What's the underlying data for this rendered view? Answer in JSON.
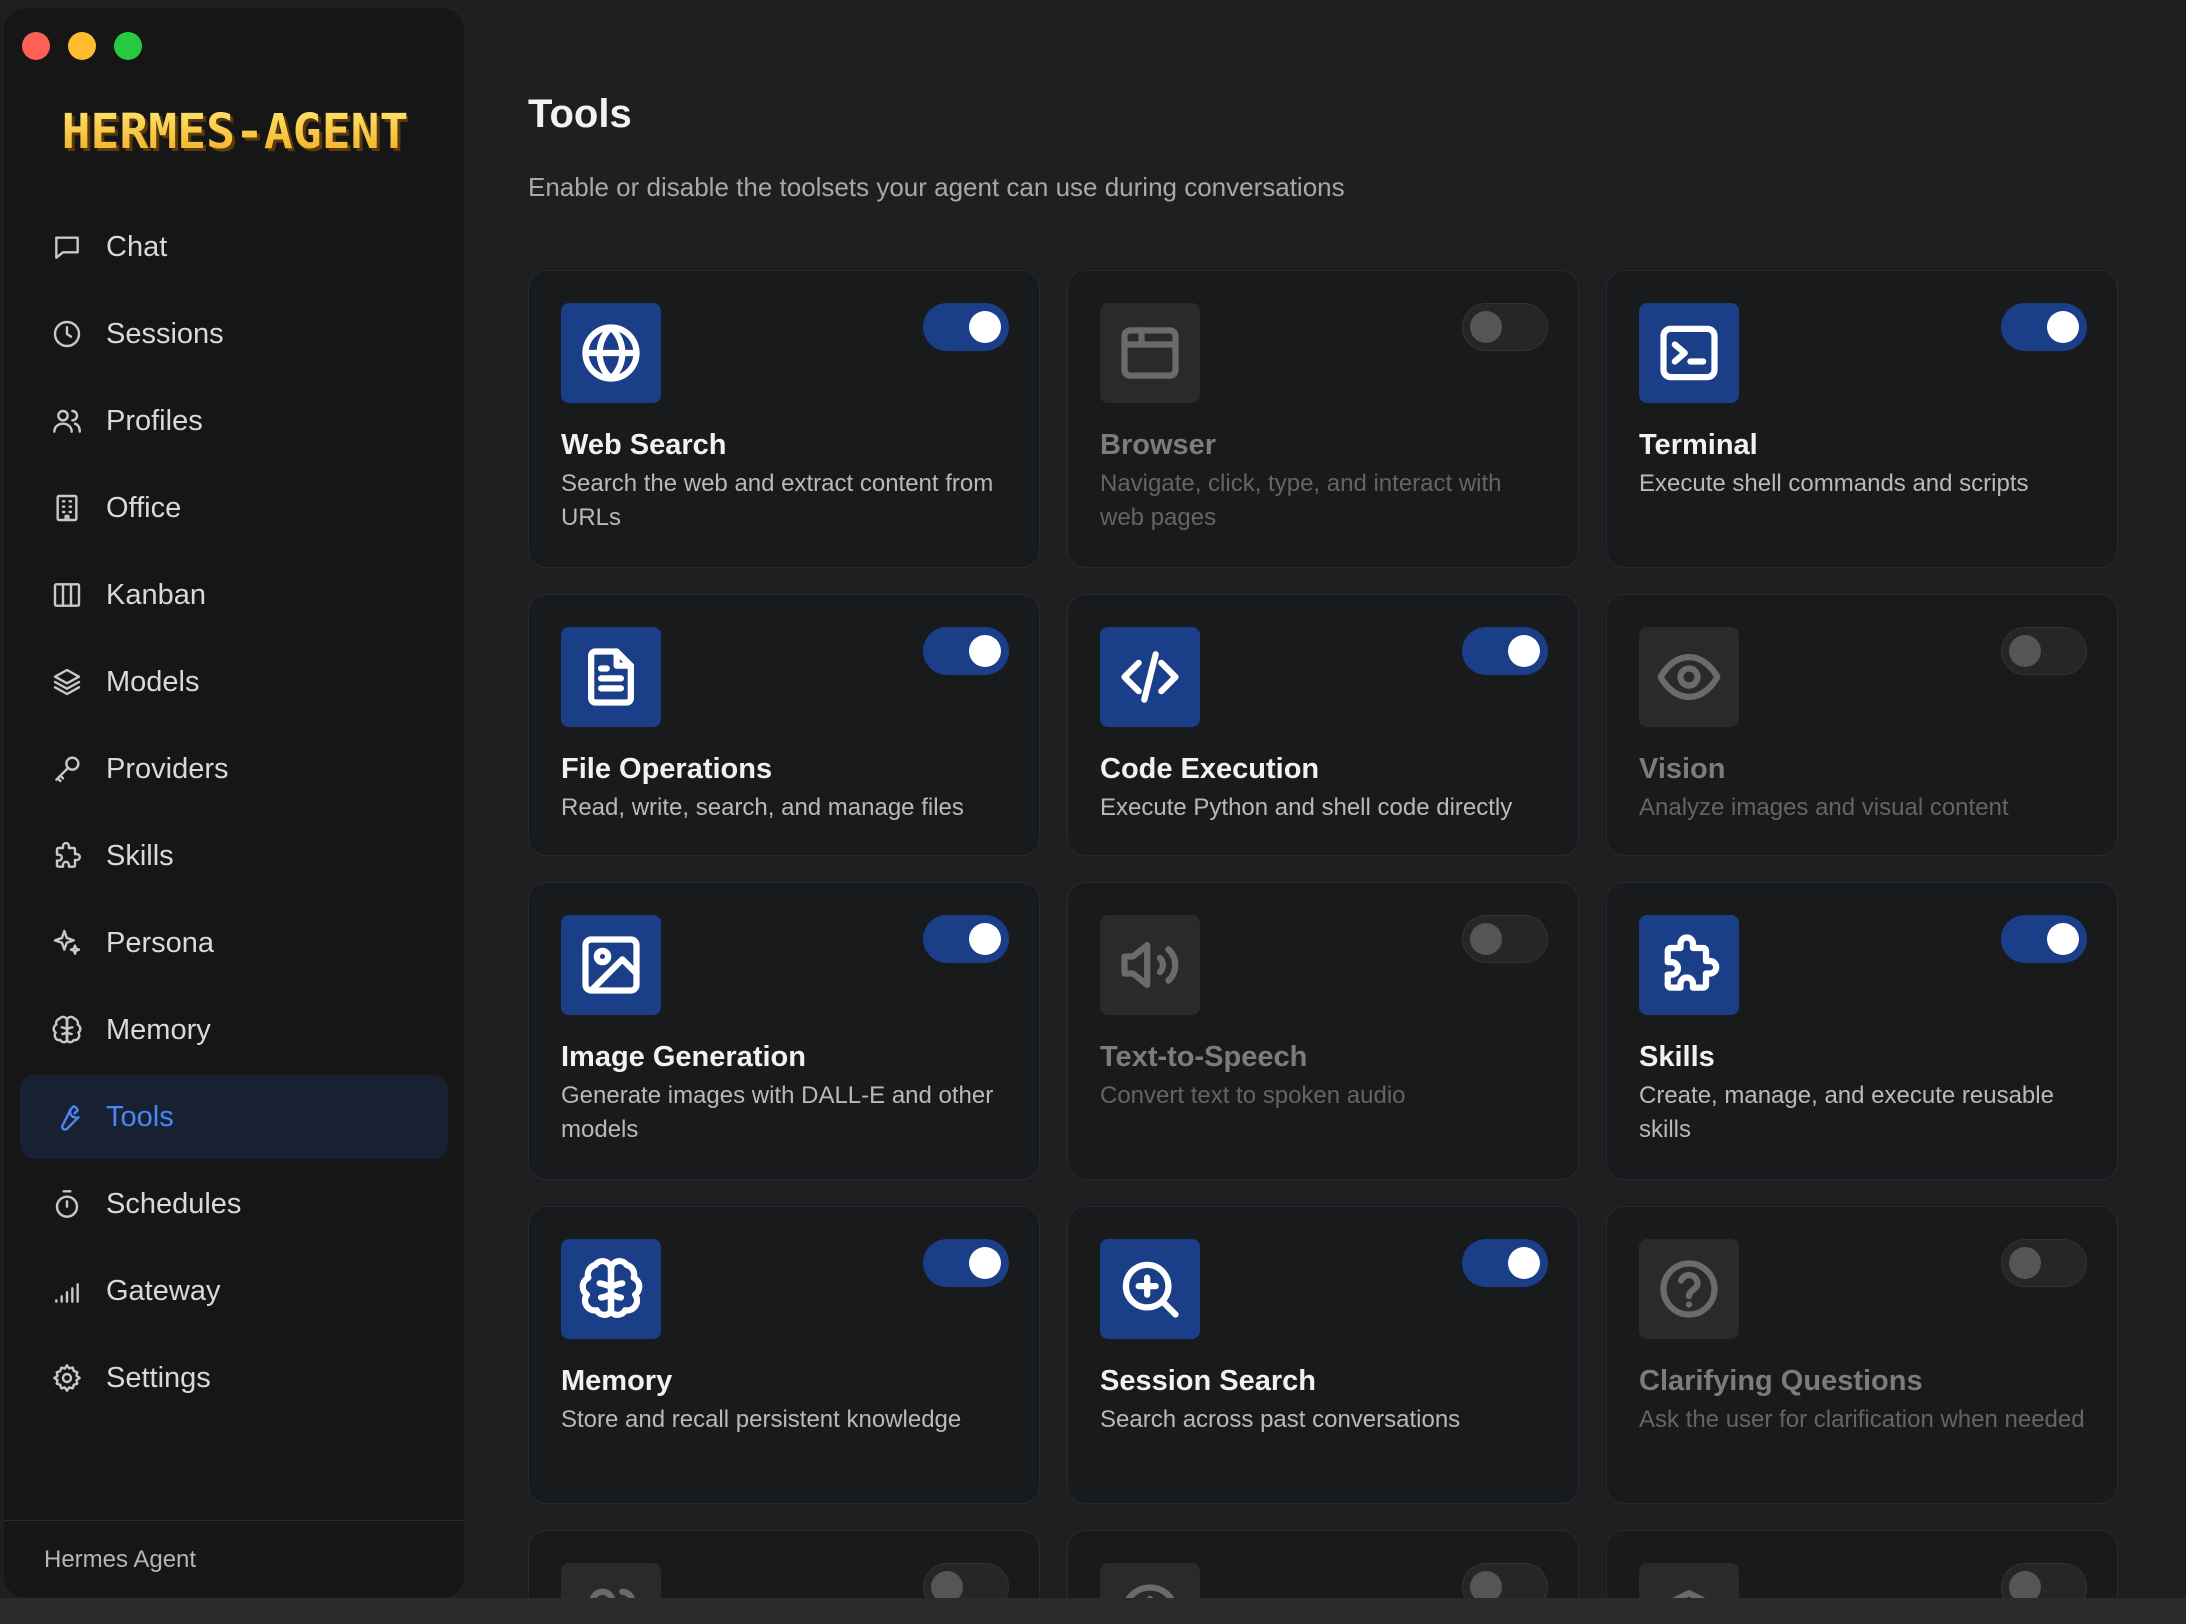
{
  "app": {
    "logo_text": "HERMES-AGENT",
    "footer_label": "Hermes Agent"
  },
  "sidebar": {
    "items": [
      {
        "label": "Chat",
        "icon": "chat-icon"
      },
      {
        "label": "Sessions",
        "icon": "clock-icon"
      },
      {
        "label": "Profiles",
        "icon": "users-icon"
      },
      {
        "label": "Office",
        "icon": "building-icon"
      },
      {
        "label": "Kanban",
        "icon": "kanban-icon"
      },
      {
        "label": "Models",
        "icon": "layers-icon"
      },
      {
        "label": "Providers",
        "icon": "key-icon"
      },
      {
        "label": "Skills",
        "icon": "puzzle-icon"
      },
      {
        "label": "Persona",
        "icon": "sparkles-icon"
      },
      {
        "label": "Memory",
        "icon": "brain-icon"
      },
      {
        "label": "Tools",
        "icon": "wrench-icon",
        "active": true
      },
      {
        "label": "Schedules",
        "icon": "timer-icon"
      },
      {
        "label": "Gateway",
        "icon": "signal-icon"
      },
      {
        "label": "Settings",
        "icon": "gear-icon"
      }
    ]
  },
  "page": {
    "title": "Tools",
    "subtitle": "Enable or disable the toolsets your agent can use during conversations"
  },
  "tools": [
    {
      "name": "Web Search",
      "description": "Search the web and extract content from URLs",
      "enabled": true,
      "icon": "globe-icon"
    },
    {
      "name": "Browser",
      "description": "Navigate, click, type, and interact with web pages",
      "enabled": false,
      "icon": "browser-window-icon"
    },
    {
      "name": "Terminal",
      "description": "Execute shell commands and scripts",
      "enabled": true,
      "icon": "terminal-icon"
    },
    {
      "name": "File Operations",
      "description": "Read, write, search, and manage files",
      "enabled": true,
      "icon": "file-text-icon"
    },
    {
      "name": "Code Execution",
      "description": "Execute Python and shell code directly",
      "enabled": true,
      "icon": "code-icon"
    },
    {
      "name": "Vision",
      "description": "Analyze images and visual content",
      "enabled": false,
      "icon": "eye-icon"
    },
    {
      "name": "Image Generation",
      "description": "Generate images with DALL-E and other models",
      "enabled": true,
      "icon": "image-icon"
    },
    {
      "name": "Text-to-Speech",
      "description": "Convert text to spoken audio",
      "enabled": false,
      "icon": "speaker-icon"
    },
    {
      "name": "Skills",
      "description": "Create, manage, and execute reusable skills",
      "enabled": true,
      "icon": "puzzle-icon"
    },
    {
      "name": "Memory",
      "description": "Store and recall persistent knowledge",
      "enabled": true,
      "icon": "brain-icon"
    },
    {
      "name": "Session Search",
      "description": "Search across past conversations",
      "enabled": true,
      "icon": "zoom-in-icon"
    },
    {
      "name": "Clarifying Questions",
      "description": "Ask the user for clarification when needed",
      "enabled": false,
      "icon": "help-circle-icon"
    },
    {
      "enabled": false,
      "icon": "users-icon"
    },
    {
      "enabled": false,
      "icon": "clock-icon"
    },
    {
      "enabled": false,
      "icon": "graduation-cap-icon"
    }
  ],
  "colors": {
    "accent": "#1a3e88",
    "active_nav_text": "#4b86f5",
    "background": "#1f1f1f",
    "sidebar": "#161616"
  }
}
